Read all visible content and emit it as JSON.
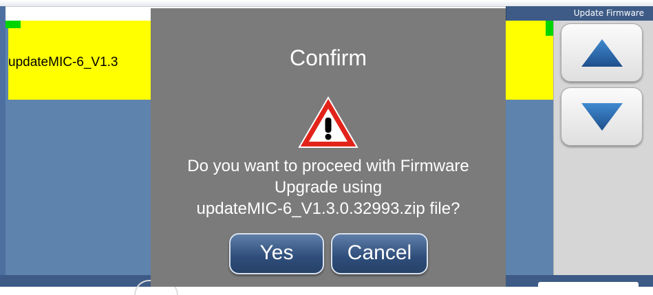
{
  "header": {
    "title": "Update Firmware"
  },
  "file_list": {
    "items": [
      {
        "label": "updateMIC-6_V1.3"
      }
    ]
  },
  "side_panel": {
    "scroll_up_icon": "triangle-up-icon",
    "scroll_down_icon": "triangle-down-icon"
  },
  "dialog": {
    "title": "Confirm",
    "icon": "warning-icon",
    "message_lines": [
      "Do you want to proceed with Firmware",
      "Upgrade using",
      "updateMIC-6_V1.3.0.32993.zip file?"
    ],
    "yes_label": "Yes",
    "cancel_label": "Cancel"
  },
  "colors": {
    "selected_row": "#ffff00",
    "list_background": "#5e84ad",
    "dialog_background": "#7b7b7b",
    "header_bar": "#3d5b86",
    "arrow_blue": "#2a64a8",
    "warning_red": "#e2231a"
  }
}
